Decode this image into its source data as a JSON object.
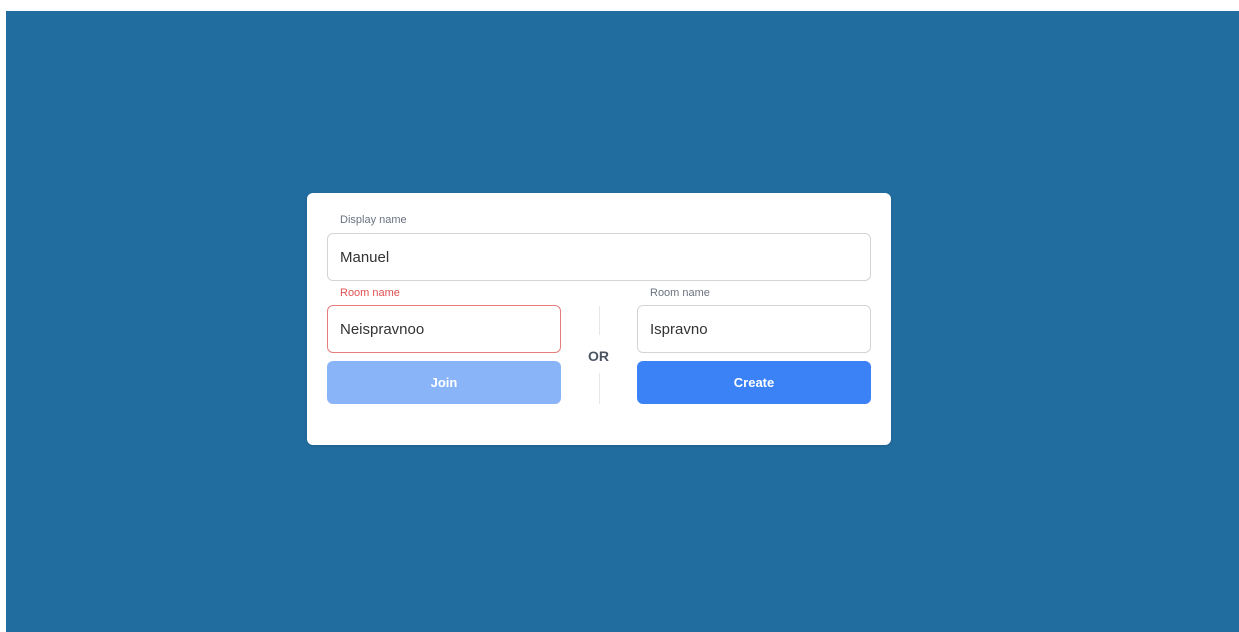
{
  "form": {
    "display_name": {
      "label": "Display name",
      "value": "Manuel"
    },
    "join": {
      "label": "Room name",
      "value": "Neispravnoo",
      "button_label": "Join",
      "state": "error"
    },
    "divider_text": "OR",
    "create": {
      "label": "Room name",
      "value": "Ispravno",
      "button_label": "Create"
    }
  },
  "colors": {
    "background": "#226d9f",
    "card": "#ffffff",
    "error": "#e05252",
    "join_button": "#8ab4f8",
    "create_button": "#3b82f6"
  }
}
